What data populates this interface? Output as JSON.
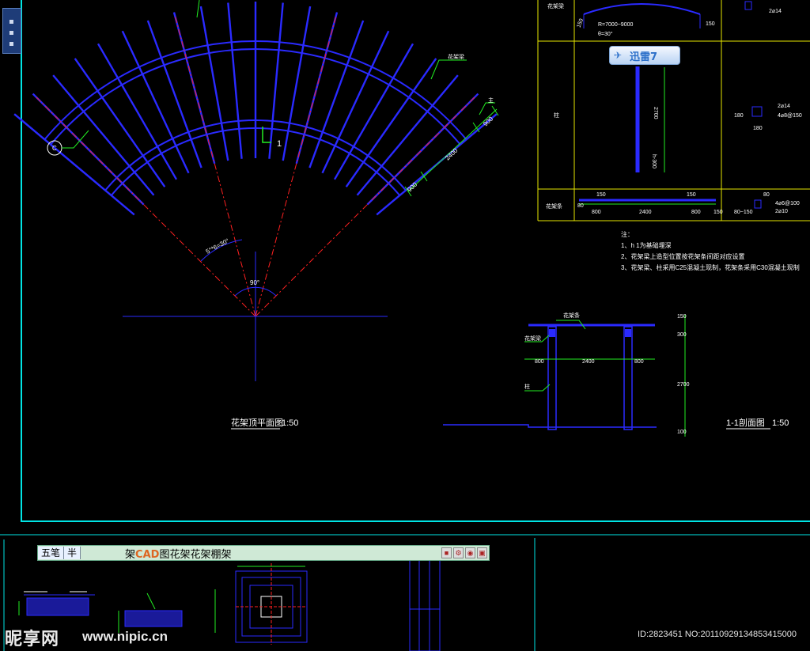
{
  "plan": {
    "label_l1": "1",
    "label_c": "C",
    "label_beam": "花架梁",
    "label_top": "主",
    "angle_small": "5°*6=30°",
    "angle_main": "90°",
    "dim_900_a": "900",
    "dim_2400": "2400",
    "dim_900_b": "900",
    "title": "花架顶平面图",
    "scale": "1:50"
  },
  "table": {
    "row1_label": "花架梁",
    "row1_r": "R=7000~9000",
    "row1_theta": "θ=30°",
    "row1_dim_left": "150",
    "row1_dim_right": "150",
    "row1_rebar": "2⌀14",
    "row2_label": "柱",
    "row2_dim_2700": "2700",
    "row2_dim_h300": "h-300",
    "row2_rebar_a": "2⌀14",
    "row2_rebar_b": "4⌀8@150",
    "row2_dim_180a": "180",
    "row2_dim_180b": "180",
    "row3_label": "花架条",
    "row3_dim_150a": "150",
    "row3_dim_150b": "150",
    "row3_dim_80": "80",
    "row3_dim_800a": "800",
    "row3_dim_2400": "2400",
    "row3_dim_800b": "800",
    "row3_dim_150c": "150",
    "row3_dim_80_150": "80~150",
    "row3_dim_80b": "80",
    "row3_rebar_a": "4⌀6@100",
    "row3_rebar_b": "2⌀10"
  },
  "notes": {
    "heading": "注：",
    "line1": "1、h 1为基础埋深",
    "line2": "2、花架梁上造型位置按花架条间距对应设置",
    "line3": "3、花架梁、柱采用C25混凝土现制，花架条采用C30混凝土现制"
  },
  "section": {
    "label_strip": "花架条",
    "label_beam": "花架梁",
    "label_col": "柱",
    "dim_800a": "800",
    "dim_2400": "2400",
    "dim_800b": "800",
    "dim_150": "150",
    "dim_300": "300",
    "dim_2700": "2700",
    "dim_100": "100",
    "title": "1-1剖面图",
    "scale": "1:50"
  },
  "ime": {
    "seg1": "五笔",
    "seg2": "半",
    "title_pre": "架",
    "title_cad": "CAD",
    "title_post": "图花架花架棚架",
    "icons": [
      "■",
      "⚙",
      "◉",
      "▣"
    ]
  },
  "thunder": {
    "label": "迅雷7"
  },
  "watermark": {
    "logo": "昵享网",
    "url": "www.nipic.cn",
    "image_id": "ID:2823451 NO:20110929134853415000"
  },
  "colors": {
    "background": "#000000",
    "frame": "#00e5e5",
    "table_border": "#e6e600",
    "drawing_lines": "#2a2aff",
    "axis_red": "#ff2020",
    "leader_green": "#22ee22"
  }
}
